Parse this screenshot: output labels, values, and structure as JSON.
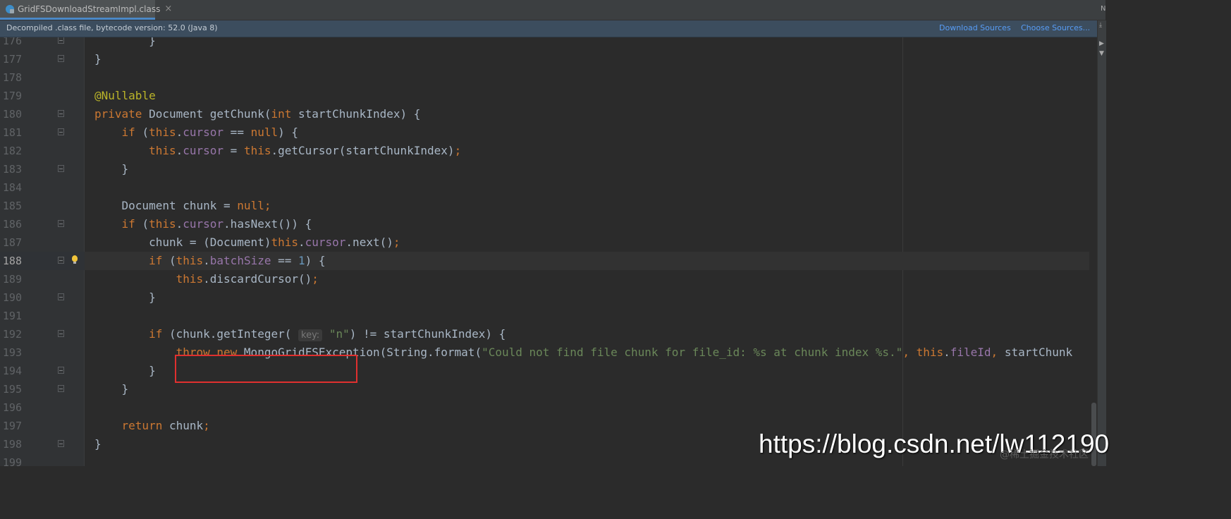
{
  "tab": {
    "label": "GridFSDownloadStreamImpl.class",
    "close_glyph": "×",
    "icon": "java-class-icon"
  },
  "corner_glyph": "N",
  "infobar": {
    "text": "Decompiled .class file, bytecode version: 52.0 (Java 8)",
    "links": [
      "Download Sources",
      "Choose Sources..."
    ]
  },
  "right_strip_glyphs": [
    "⤓",
    "▶",
    "▼"
  ],
  "colors": {
    "keyword": "#cc7832",
    "field": "#9876aa",
    "annotation": "#bbb529",
    "number": "#6897bb",
    "string": "#6a8759",
    "plain": "#a9b7c6",
    "highlight_box": "#e0302f"
  },
  "current_line": "188",
  "code_lines": [
    {
      "n": "176",
      "fold": true,
      "segs": [
        [
          "plain",
          "        }"
        ]
      ]
    },
    {
      "n": "177",
      "fold": true,
      "segs": [
        [
          "plain",
          "}"
        ]
      ]
    },
    {
      "n": "178",
      "segs": []
    },
    {
      "n": "179",
      "segs": [
        [
          "ann",
          "@Nullable"
        ]
      ]
    },
    {
      "n": "180",
      "fold": true,
      "segs": [
        [
          "kw",
          "private "
        ],
        [
          "plain",
          "Document getChunk("
        ],
        [
          "kw",
          "int "
        ],
        [
          "plain",
          "startChunkIndex) {"
        ]
      ]
    },
    {
      "n": "181",
      "fold": true,
      "segs": [
        [
          "plain",
          "    "
        ],
        [
          "kw",
          "if "
        ],
        [
          "plain",
          "("
        ],
        [
          "kw",
          "this"
        ],
        [
          "plain",
          "."
        ],
        [
          "fld",
          "cursor"
        ],
        [
          "plain",
          " == "
        ],
        [
          "kw",
          "null"
        ],
        [
          "plain",
          ") {"
        ]
      ]
    },
    {
      "n": "182",
      "segs": [
        [
          "plain",
          "        "
        ],
        [
          "kw",
          "this"
        ],
        [
          "plain",
          "."
        ],
        [
          "fld",
          "cursor"
        ],
        [
          "plain",
          " = "
        ],
        [
          "kw",
          "this"
        ],
        [
          "plain",
          ".getCursor(startChunkIndex)"
        ],
        [
          "kw",
          ";"
        ]
      ]
    },
    {
      "n": "183",
      "fold": true,
      "segs": [
        [
          "plain",
          "    }"
        ]
      ]
    },
    {
      "n": "184",
      "segs": []
    },
    {
      "n": "185",
      "segs": [
        [
          "plain",
          "    Document chunk = "
        ],
        [
          "kw",
          "null;"
        ]
      ]
    },
    {
      "n": "186",
      "fold": true,
      "segs": [
        [
          "plain",
          "    "
        ],
        [
          "kw",
          "if "
        ],
        [
          "plain",
          "("
        ],
        [
          "kw",
          "this"
        ],
        [
          "plain",
          "."
        ],
        [
          "fld",
          "cursor"
        ],
        [
          "plain",
          ".hasNext()) {"
        ]
      ]
    },
    {
      "n": "187",
      "segs": [
        [
          "plain",
          "        chunk = (Document)"
        ],
        [
          "kw",
          "this"
        ],
        [
          "plain",
          "."
        ],
        [
          "fld",
          "cursor"
        ],
        [
          "plain",
          ".next()"
        ],
        [
          "kw",
          ";"
        ]
      ]
    },
    {
      "n": "188",
      "fold": true,
      "bulb": true,
      "segs": [
        [
          "plain",
          "        "
        ],
        [
          "kw",
          "if "
        ],
        [
          "plain",
          "("
        ],
        [
          "kw",
          "this"
        ],
        [
          "plain",
          "."
        ],
        [
          "fld",
          "batchSize"
        ],
        [
          "plain",
          " == "
        ],
        [
          "num",
          "1"
        ],
        [
          "plain",
          ") {"
        ]
      ]
    },
    {
      "n": "189",
      "segs": [
        [
          "plain",
          "            "
        ],
        [
          "kw",
          "this"
        ],
        [
          "plain",
          ".discardCursor()"
        ],
        [
          "kw",
          ";"
        ]
      ]
    },
    {
      "n": "190",
      "fold": true,
      "segs": [
        [
          "plain",
          "        }"
        ]
      ]
    },
    {
      "n": "191",
      "segs": []
    },
    {
      "n": "192",
      "fold": true,
      "segs": [
        [
          "plain",
          "        "
        ],
        [
          "kw",
          "if "
        ],
        [
          "plain",
          "(chunk.getInteger( "
        ],
        [
          "hint",
          "key:"
        ],
        [
          "str",
          " \"n\""
        ],
        [
          "plain",
          ") != startChunkIndex) {"
        ]
      ]
    },
    {
      "n": "193",
      "segs": [
        [
          "plain",
          "            "
        ],
        [
          "kw",
          "throw new "
        ],
        [
          "plain",
          "MongoGridFSException(String."
        ],
        [
          "plain",
          "format("
        ],
        [
          "str",
          "\"Could not find file chunk for file_id: %s at chunk index %s.\""
        ],
        [
          "kw",
          ", "
        ],
        [
          "kw",
          "this"
        ],
        [
          "plain",
          "."
        ],
        [
          "fld",
          "fileId"
        ],
        [
          "kw",
          ", "
        ],
        [
          "plain",
          "startChunk"
        ]
      ]
    },
    {
      "n": "194",
      "fold": true,
      "segs": [
        [
          "plain",
          "        }"
        ]
      ]
    },
    {
      "n": "195",
      "fold": true,
      "segs": [
        [
          "plain",
          "    }"
        ]
      ]
    },
    {
      "n": "196",
      "segs": []
    },
    {
      "n": "197",
      "segs": [
        [
          "plain",
          "    "
        ],
        [
          "kw",
          "return "
        ],
        [
          "plain",
          "chunk"
        ],
        [
          "kw",
          ";"
        ]
      ]
    },
    {
      "n": "198",
      "fold": true,
      "segs": [
        [
          "plain",
          "}"
        ]
      ]
    },
    {
      "n": "199",
      "segs": []
    }
  ],
  "watermark": "https://blog.csdn.net/lw112190",
  "watermark_faint": "@稀土掘金技术社区"
}
